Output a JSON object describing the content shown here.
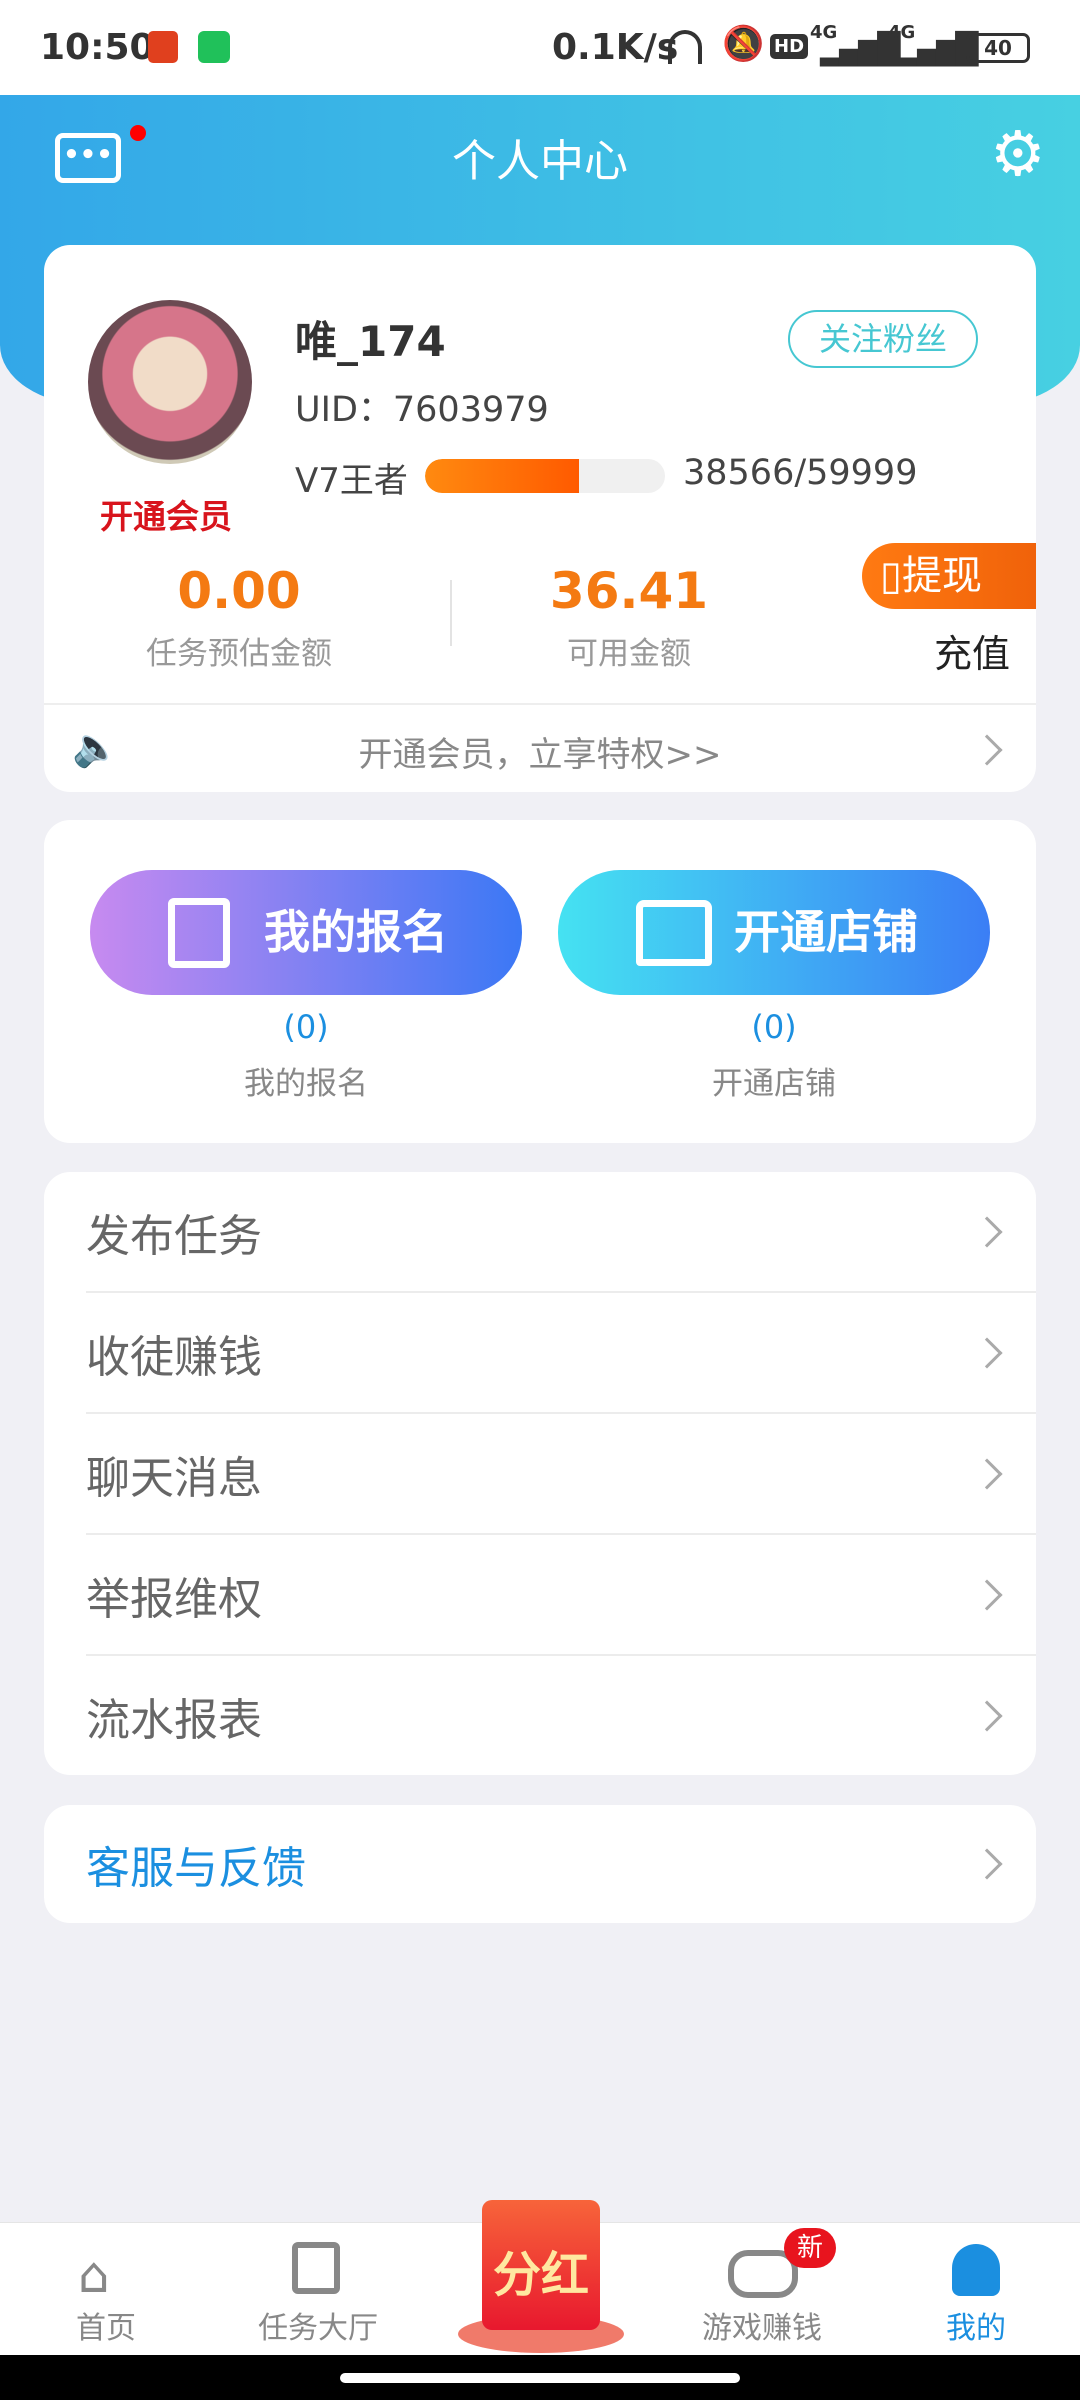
{
  "status": {
    "time": "10:50",
    "speed": "0.1K/s",
    "net1": "4G",
    "net2": "4G",
    "battery": "40",
    "hd": "HD"
  },
  "header": {
    "title": "个人中心"
  },
  "profile": {
    "name": "唯_174",
    "uid": "UID：7603979",
    "level": "V7王者",
    "progress_text": "38566/59999",
    "progress": 0.643,
    "vip_link": "开通会员",
    "follow_button": "关注粉丝"
  },
  "balance": {
    "estimated_value": "0.00",
    "estimated_label": "任务预估金额",
    "available_value": "36.41",
    "available_label": "可用金额",
    "withdraw": "提现",
    "recharge": "充值"
  },
  "banner": {
    "text": "开通会员，立享特权>>"
  },
  "actions": [
    {
      "label": "我的报名",
      "count": "(0)",
      "caption": "我的报名"
    },
    {
      "label": "开通店铺",
      "count": "(0)",
      "caption": "开通店铺"
    }
  ],
  "menu": [
    "发布任务",
    "收徒赚钱",
    "聊天消息",
    "举报维权",
    "流水报表"
  ],
  "service": "客服与反馈",
  "nav": {
    "items": [
      "首页",
      "任务大厅",
      "游戏赚钱",
      "我的"
    ],
    "center": "分红",
    "badge": "新"
  },
  "colors": {
    "accent": "#2fb5e6",
    "orange": "#f47a12",
    "active": "#1b8fe0"
  }
}
